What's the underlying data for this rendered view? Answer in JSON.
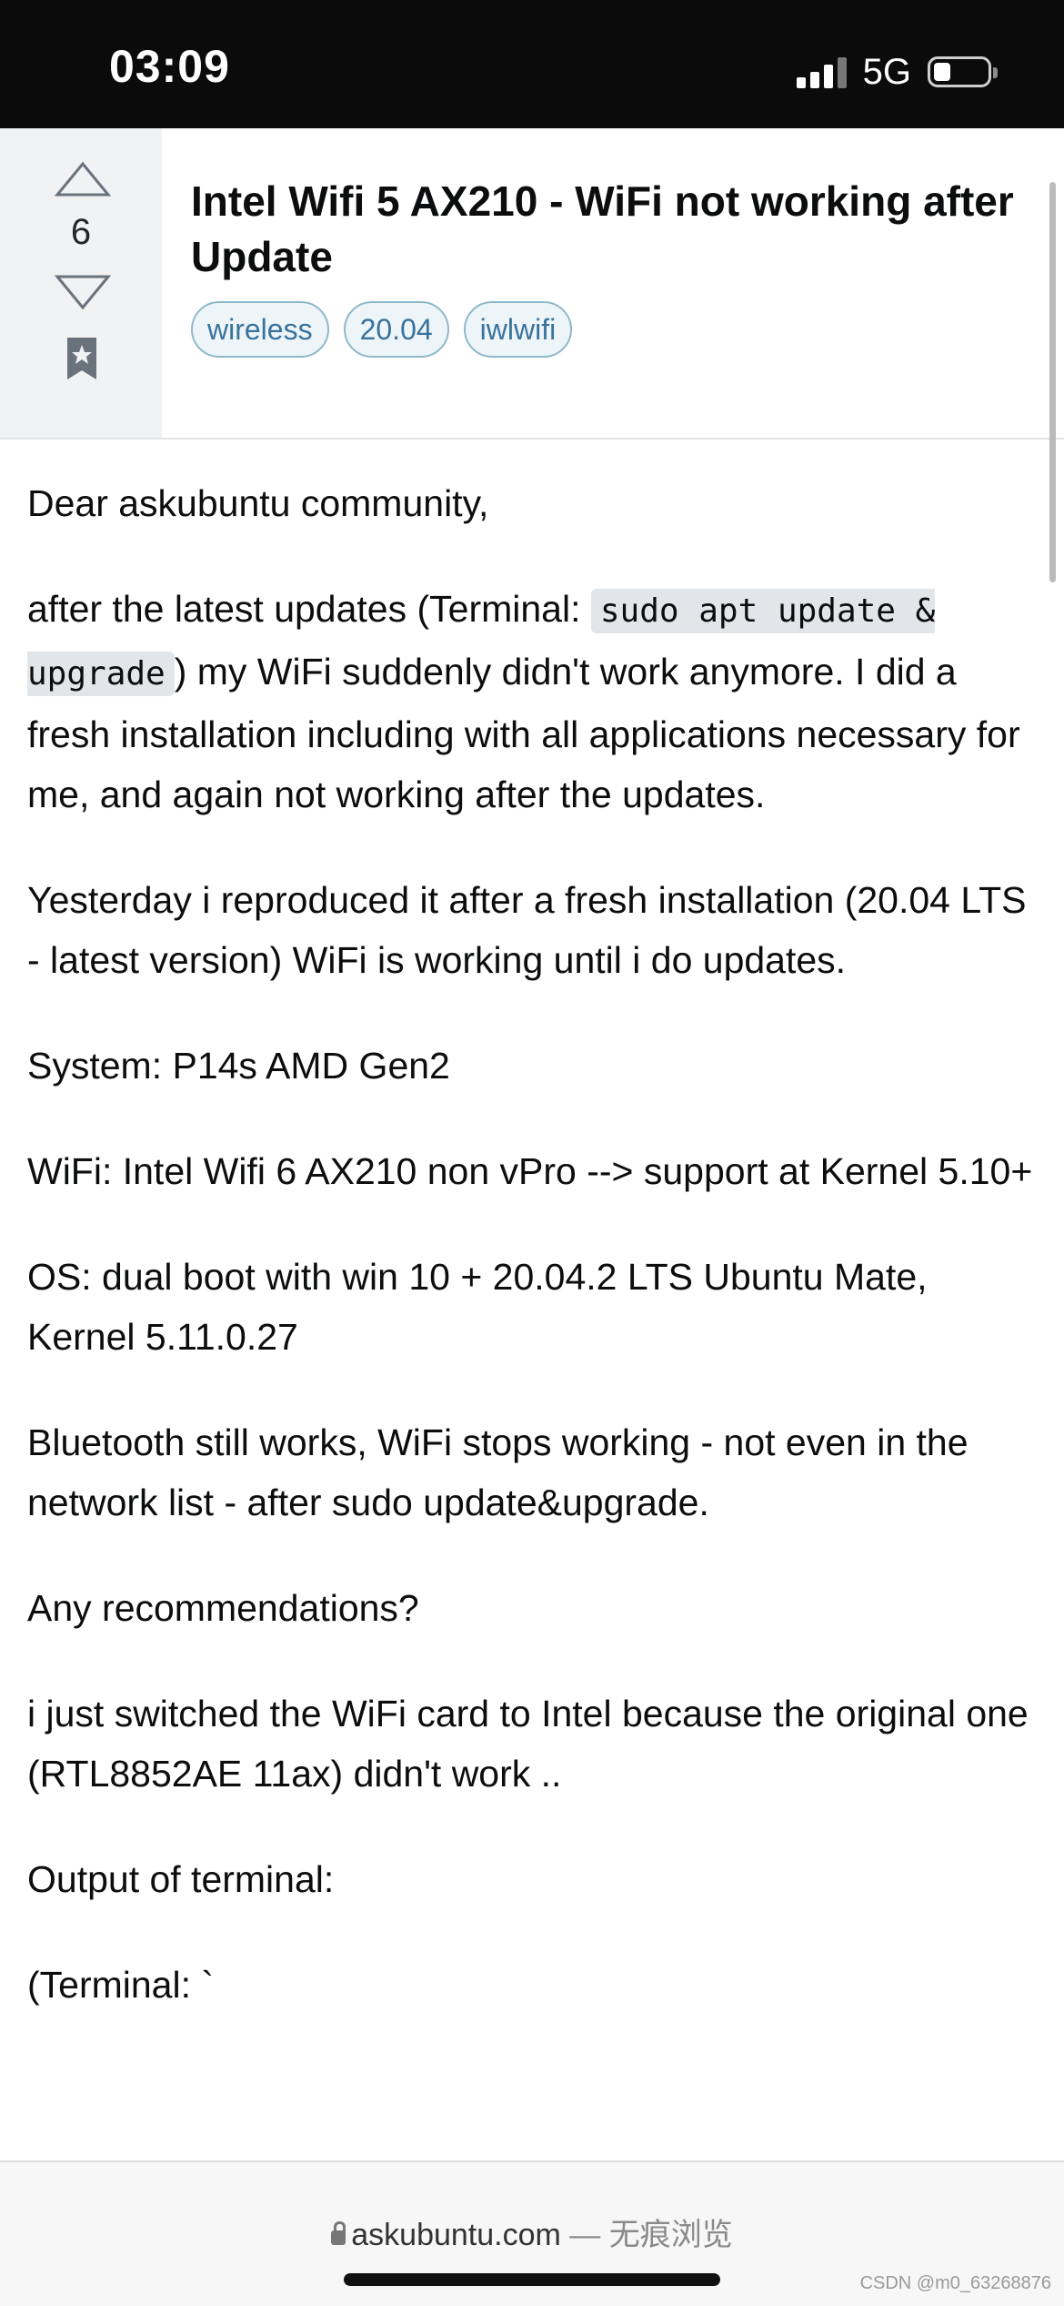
{
  "status_bar": {
    "time": "03:09",
    "network": "5G",
    "icons": [
      "signal-icon",
      "battery-icon"
    ]
  },
  "question": {
    "vote_count": "6",
    "title": "Intel Wifi 5 AX210 - WiFi not working after Update",
    "tags": [
      "wireless",
      "20.04",
      "iwlwifi"
    ],
    "icons": [
      "vote-up-icon",
      "vote-down-icon",
      "bookmark-icon"
    ]
  },
  "body": {
    "p1": "Dear askubuntu community,",
    "p2_before": "after the latest updates (Terminal: ",
    "p2_code": "sudo apt update & upgrade",
    "p2_after": ") my WiFi suddenly didn't work anymore. I did a fresh installation including with all applications necessary for me, and again not working after the updates.",
    "p3": "Yesterday i reproduced it after a fresh installation (20.04 LTS - latest version) WiFi is working until i do updates.",
    "p4": "System: P14s AMD Gen2",
    "p5": "WiFi: Intel Wifi 6 AX210 non vPro --> support at Kernel 5.10+",
    "p6": "OS: dual boot with win 10 + 20.04.2 LTS Ubuntu Mate, Kernel 5.11.0.27",
    "p7": "Bluetooth still works, WiFi stops working - not even in the network list - after sudo update&upgrade.",
    "p8": "Any recommendations?",
    "p9": "i just switched the WiFi card to Intel because the original one (RTL8852AE 11ax) didn't work ..",
    "p10": "Output of terminal:",
    "p11": "(Terminal: `"
  },
  "browser_bar": {
    "domain": "askubuntu.com",
    "suffix": " — 无痕浏览",
    "icon": "lock-icon"
  },
  "watermark": "CSDN @m0_63268876"
}
